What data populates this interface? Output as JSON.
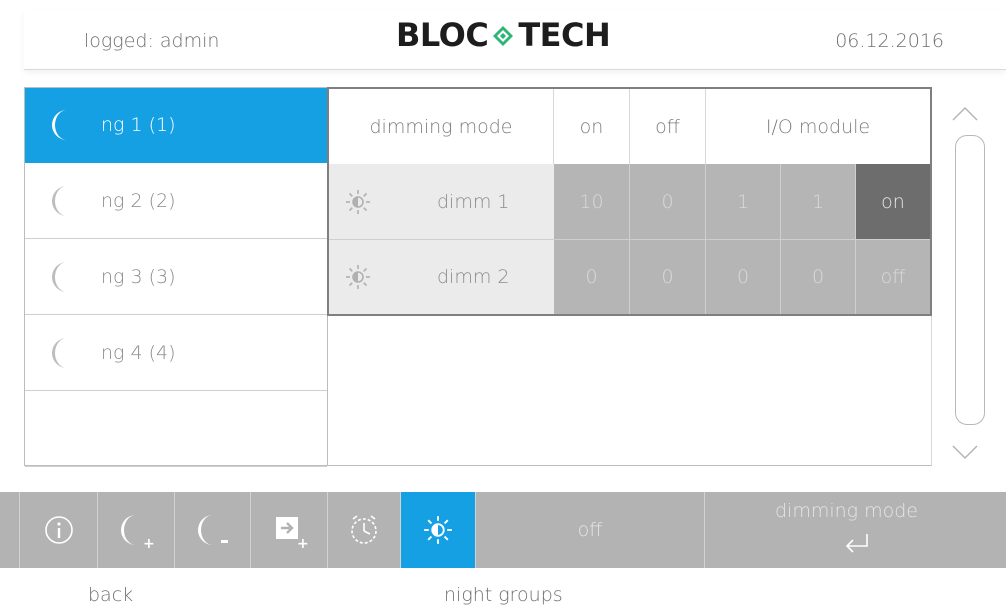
{
  "header": {
    "user": "logged: admin",
    "logo_left": "BLOC",
    "logo_right": "TECH",
    "date": "06.12.2016"
  },
  "night_groups": [
    {
      "label": "ng 1 (1)",
      "active": true
    },
    {
      "label": "ng 2 (2)",
      "active": false
    },
    {
      "label": "ng 3 (3)",
      "active": false
    },
    {
      "label": "ng 4 (4)",
      "active": false
    }
  ],
  "table": {
    "headers": [
      "dimming mode",
      "on",
      "off",
      "I/O module"
    ],
    "rows": [
      {
        "name": "dimm 1",
        "values": [
          "10",
          "0",
          "1",
          "1"
        ],
        "state": "on"
      },
      {
        "name": "dimm 2",
        "values": [
          "0",
          "0",
          "0",
          "0"
        ],
        "state": "off"
      }
    ]
  },
  "toolbar": {
    "icons": [
      "info-icon",
      "add-night-group-icon",
      "remove-night-group-icon",
      "add-module-icon",
      "timer-icon",
      "dimming-icon"
    ],
    "status": "off",
    "dimming_mode_label": "dimming mode"
  },
  "footer": {
    "back": "back",
    "title": "night groups"
  },
  "colors": {
    "accent": "#16a0e4",
    "cell_grey": "#b5b5b5",
    "cell_dark": "#6d6d6d",
    "toolbar": "#b3b3b3"
  }
}
